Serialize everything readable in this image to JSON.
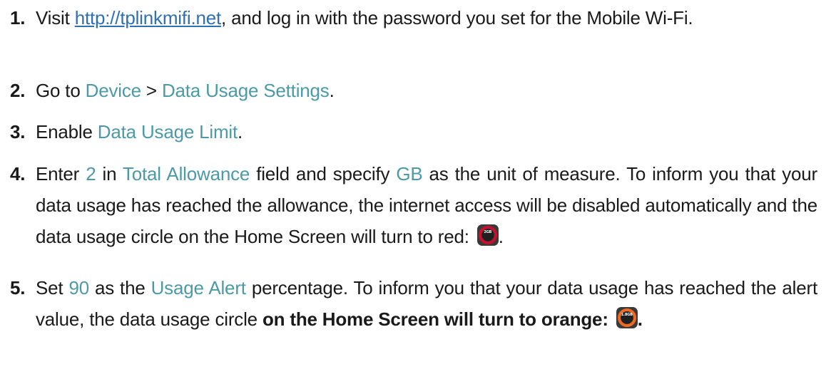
{
  "steps": [
    {
      "number": "1.",
      "text_before": "Visit ",
      "link": "http://tplinkmifi.net",
      "text_after": ", and log in with the password you set for the Mobile Wi-Fi."
    },
    {
      "number": "2.",
      "text_before": "Go to ",
      "menu_1": "Device",
      "separator": " > ",
      "menu_2": "Data Usage Settings",
      "text_after": "."
    },
    {
      "number": "3.",
      "text_before": "Enable ",
      "setting": "Data Usage Limit",
      "text_after": "."
    },
    {
      "number": "4.",
      "text_1": "Enter ",
      "value": "2",
      "text_2": " in ",
      "field": "Total Allowance",
      "text_3": " field and specify ",
      "unit": "GB",
      "text_4": " as the unit of measure. To inform you that your data usage has reached the allowance, the internet access will be disabled automatically and the data usage circle on the Home Screen will turn to red: ",
      "icon_label": "2GB",
      "text_5": "."
    },
    {
      "number": "5.",
      "text_1": "Set ",
      "value": "90",
      "text_2": " as the ",
      "field": "Usage Alert",
      "text_3": " percentage. To inform you that your data usage has reached the alert value, the data usage circle ",
      "bold_text": "on the Home Screen will turn to orange: ",
      "icon_label": "1.8GB",
      "bold_end": "."
    }
  ],
  "colors": {
    "highlight": "#4c9aa8",
    "link": "#2f6fb3",
    "red_ring": "#c8102e",
    "orange_ring": "#f26a21"
  },
  "icons": {
    "red": "data-usage-circle-red-icon",
    "orange": "data-usage-circle-orange-icon"
  }
}
